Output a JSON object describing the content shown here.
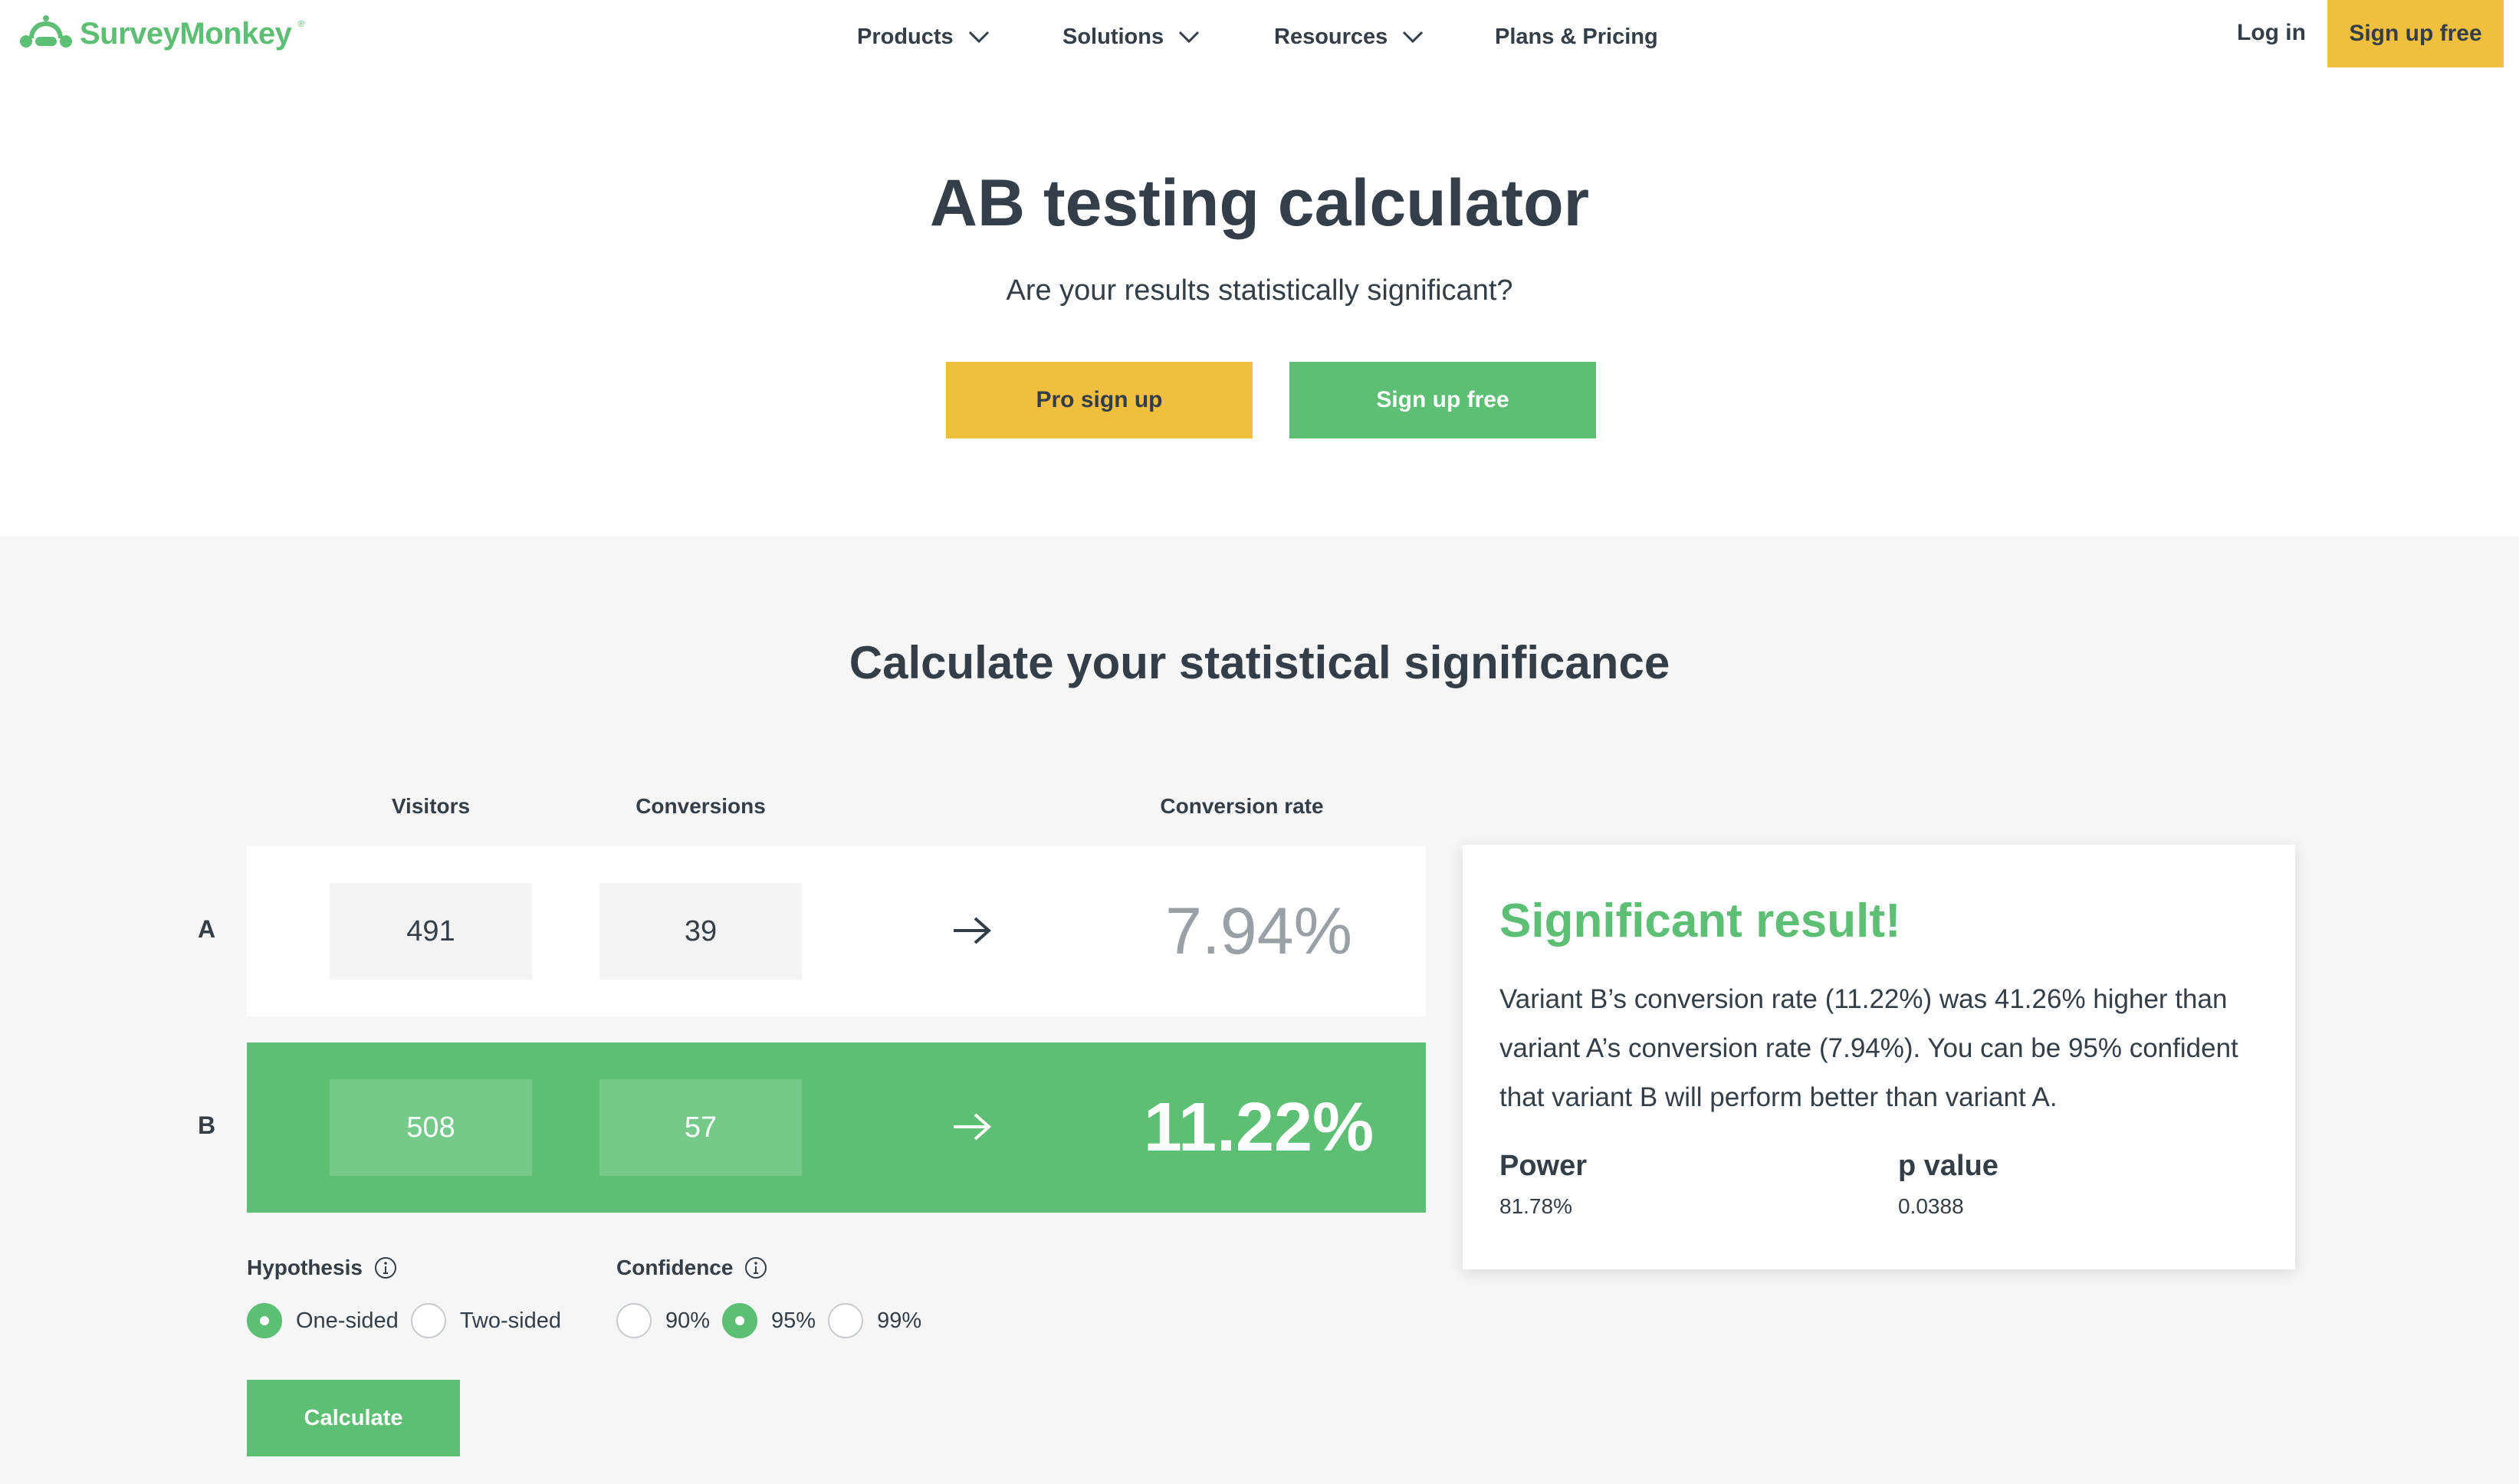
{
  "brand": {
    "name": "SurveyMonkey",
    "reg": "®",
    "color": "#5cbf73"
  },
  "nav": {
    "items": [
      {
        "label": "Products",
        "has_dropdown": true
      },
      {
        "label": "Solutions",
        "has_dropdown": true
      },
      {
        "label": "Resources",
        "has_dropdown": true
      },
      {
        "label": "Plans & Pricing",
        "has_dropdown": false
      }
    ],
    "login": "Log in",
    "signup": "Sign up free"
  },
  "hero": {
    "title": "AB testing calculator",
    "subtitle": "Are your results statistically significant?",
    "pro_button": "Pro sign up",
    "free_button": "Sign up free"
  },
  "calculator": {
    "title": "Calculate your statistical significance",
    "columns": {
      "visitors": "Visitors",
      "conversions": "Conversions",
      "rate": "Conversion rate"
    },
    "variants": [
      {
        "label": "A",
        "visitors": "491",
        "conversions": "39",
        "rate": "7.94%"
      },
      {
        "label": "B",
        "visitors": "508",
        "conversions": "57",
        "rate": "11.22%"
      }
    ],
    "hypothesis": {
      "label": "Hypothesis",
      "options": [
        {
          "label": "One-sided",
          "selected": true
        },
        {
          "label": "Two-sided",
          "selected": false
        }
      ]
    },
    "confidence": {
      "label": "Confidence",
      "options": [
        {
          "label": "90%",
          "selected": false
        },
        {
          "label": "95%",
          "selected": true
        },
        {
          "label": "99%",
          "selected": false
        }
      ]
    },
    "calculate_button": "Calculate"
  },
  "result": {
    "title": "Significant result!",
    "text": "Variant B’s conversion rate (11.22%) was 41.26% higher than variant A’s conversion rate (7.94%). You can be 95% confident that variant B will perform better than variant A.",
    "power_label": "Power",
    "power_value": "81.78%",
    "pvalue_label": "p value",
    "pvalue_value": "0.0388"
  },
  "colors": {
    "green": "#5cbf73",
    "yellow": "#f0bf3d",
    "text": "#333e48",
    "section_bg": "#f6f6f6"
  }
}
